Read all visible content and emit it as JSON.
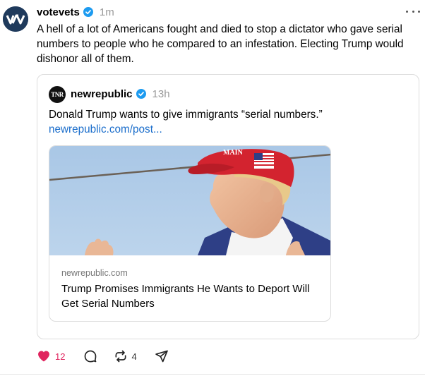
{
  "post": {
    "author": "votevets",
    "time": "1m",
    "text": "A hell of a lot of Americans fought and died to stop a dictator who gave serial numbers to people who he compared to an infestation. Electing Trump would dishonor all of them."
  },
  "quote": {
    "avatar_text": "TNR",
    "author": "newrepublic",
    "time": "13h",
    "text": "Donald Trump wants to give immigrants “serial numbers.”",
    "link": "newrepublic.com/post..."
  },
  "link_card": {
    "domain": "newrepublic.com",
    "title": "Trump Promises Immigrants He Wants to Deport Will Get Serial Numbers",
    "cap_text": "MAIN"
  },
  "actions": {
    "likes": "12",
    "reposts": "4"
  },
  "colors": {
    "like": "#e0245e",
    "verified": "#1d9bf0",
    "link": "#1a6dcb"
  },
  "icons": [
    "votevets-logo",
    "verified-badge-icon",
    "more-options-icon",
    "heart-icon",
    "comment-icon",
    "repost-icon",
    "share-icon"
  ]
}
